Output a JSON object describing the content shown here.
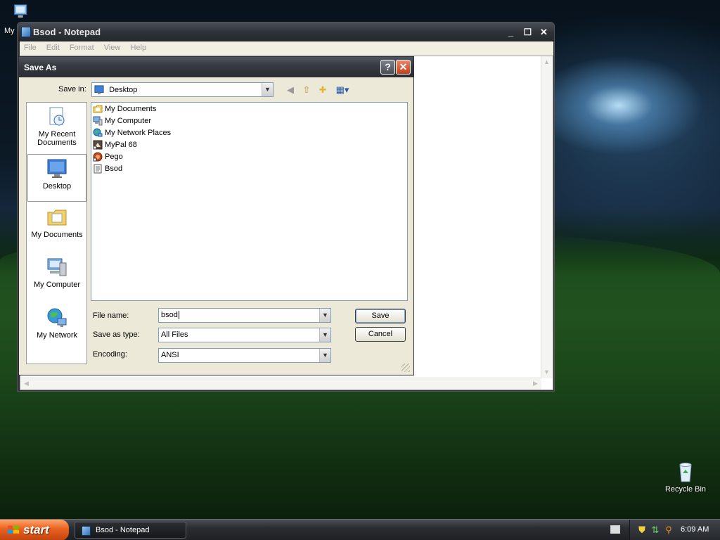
{
  "desktop": {
    "icons": [
      {
        "label": "My",
        "icon": "my-documents-icon"
      },
      {
        "label": "Recycle Bin",
        "icon": "recycle-bin-icon"
      }
    ]
  },
  "notepad": {
    "title": "Bsod - Notepad",
    "menu": [
      "File",
      "Edit",
      "Format",
      "View",
      "Help"
    ]
  },
  "dialog": {
    "title": "Save As",
    "help_label": "?",
    "close_label": "✕",
    "save_in_label": "Save in:",
    "save_in_value": "Desktop",
    "places": [
      {
        "label": "My Recent Documents",
        "icon": "recent-documents-icon"
      },
      {
        "label": "Desktop",
        "icon": "desktop-icon",
        "selected": true
      },
      {
        "label": "My Documents",
        "icon": "my-documents-icon"
      },
      {
        "label": "My Computer",
        "icon": "my-computer-icon"
      },
      {
        "label": "My Network",
        "icon": "network-icon"
      }
    ],
    "files": [
      {
        "name": "My Documents",
        "icon": "folder-icon"
      },
      {
        "name": "My Computer",
        "icon": "computer-icon"
      },
      {
        "name": "My Network Places",
        "icon": "network-places-icon"
      },
      {
        "name": "MyPal 68",
        "icon": "shortcut-icon"
      },
      {
        "name": "Pego",
        "icon": "app-icon"
      },
      {
        "name": "Bsod",
        "icon": "text-file-icon"
      }
    ],
    "file_name_label": "File name:",
    "file_name_value": "bsod",
    "save_as_type_label": "Save as type:",
    "save_as_type_value": "All Files",
    "encoding_label": "Encoding:",
    "encoding_value": "ANSI",
    "save_button": "Save",
    "cancel_button": "Cancel"
  },
  "taskbar": {
    "start_label": "start",
    "task_label": "Bsod - Notepad",
    "clock": "6:09 AM"
  }
}
